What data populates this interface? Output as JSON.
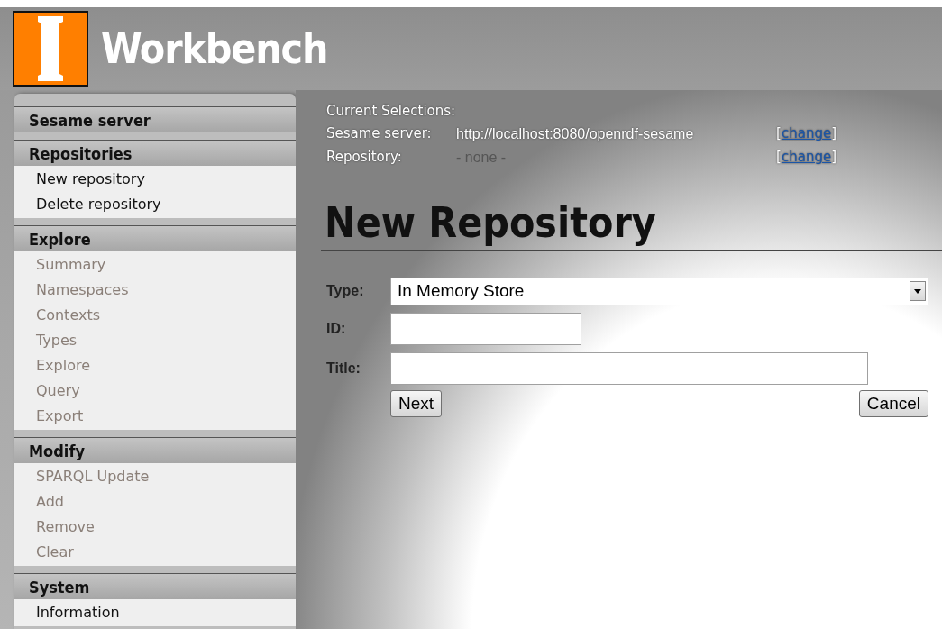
{
  "header": {
    "title": "Workbench"
  },
  "sidebar": {
    "sections": [
      {
        "title": "Sesame server"
      },
      {
        "title": "Repositories",
        "items": [
          {
            "label": "New repository",
            "disabled": false
          },
          {
            "label": "Delete repository",
            "disabled": false
          }
        ]
      },
      {
        "title": "Explore",
        "items": [
          {
            "label": "Summary",
            "disabled": true
          },
          {
            "label": "Namespaces",
            "disabled": true
          },
          {
            "label": "Contexts",
            "disabled": true
          },
          {
            "label": "Types",
            "disabled": true
          },
          {
            "label": "Explore",
            "disabled": true
          },
          {
            "label": "Query",
            "disabled": true
          },
          {
            "label": "Export",
            "disabled": true
          }
        ]
      },
      {
        "title": "Modify",
        "items": [
          {
            "label": "SPARQL Update",
            "disabled": true
          },
          {
            "label": "Add",
            "disabled": true
          },
          {
            "label": "Remove",
            "disabled": true
          },
          {
            "label": "Clear",
            "disabled": true
          }
        ]
      },
      {
        "title": "System",
        "items": [
          {
            "label": "Information",
            "disabled": false
          }
        ]
      }
    ]
  },
  "selections": {
    "title": "Current Selections:",
    "rows": [
      {
        "label": "Sesame server:",
        "value": "http://localhost:8080/openrdf-sesame",
        "empty": false,
        "open": "[",
        "link": "change",
        "close": "]"
      },
      {
        "label": "Repository:",
        "value": "- none -",
        "empty": true,
        "open": "[",
        "link": "change",
        "close": "]"
      }
    ]
  },
  "page_title": "New Repository",
  "form": {
    "fields": [
      {
        "kind": "select",
        "label": "Type:",
        "value": "In Memory Store"
      },
      {
        "kind": "short",
        "label": "ID:"
      },
      {
        "kind": "long",
        "label": "Title:"
      }
    ],
    "buttons": [
      "Next",
      "Cancel"
    ]
  }
}
